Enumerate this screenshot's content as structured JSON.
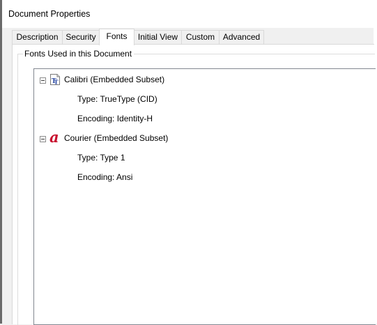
{
  "window": {
    "title": "Document Properties"
  },
  "tabs": [
    {
      "label": "Description",
      "active": false
    },
    {
      "label": "Security",
      "active": false
    },
    {
      "label": "Fonts",
      "active": true
    },
    {
      "label": "Initial View",
      "active": false
    },
    {
      "label": "Custom",
      "active": false
    },
    {
      "label": "Advanced",
      "active": false
    }
  ],
  "fonts_group": {
    "label": "Fonts Used in this Document",
    "fonts": [
      {
        "name": "Calibri (Embedded Subset)",
        "icon": "truetype-font-icon",
        "type": "Type: TrueType (CID)",
        "encoding": "Encoding: Identity-H",
        "expanded": true
      },
      {
        "name": "Courier (Embedded Subset)",
        "icon": "type1-font-icon",
        "type": "Type: Type 1",
        "encoding": "Encoding: Ansi",
        "expanded": true
      }
    ]
  },
  "colors": {
    "type1_icon": "#c8102e",
    "tree_border": "#828790",
    "truetype_icon_text": "#1f3f9f"
  }
}
